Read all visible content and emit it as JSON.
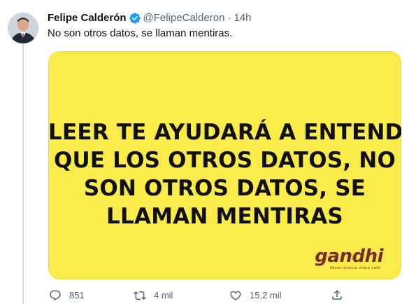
{
  "author": {
    "display_name": "Felipe Calderón",
    "handle": "@FelipeCalderon",
    "separator": "·",
    "time": "14h",
    "verified": true
  },
  "tweet": {
    "text": "No son otros datos, se llaman mentiras."
  },
  "media": {
    "background_color": "#f9ec4a",
    "lines": [
      "LEER TE AYUDARÁ A ENTENDER",
      "QUE LOS OTROS DATOS, NO",
      "SON OTROS DATOS, SE",
      "LLAMAN MENTIRAS"
    ],
    "brand": {
      "name": "gandhi",
      "tagline": "libros música video café"
    }
  },
  "actions": {
    "reply": {
      "icon": "reply-icon",
      "count": "851"
    },
    "retweet": {
      "icon": "retweet-icon",
      "count": "4 mil"
    },
    "like": {
      "icon": "heart-icon",
      "count": "15,2 mil"
    },
    "share": {
      "icon": "share-icon"
    }
  },
  "colors": {
    "text_primary": "#0f1419",
    "text_secondary": "#536471",
    "verified_blue": "#1d9bf0",
    "media_yellow": "#f9ec4a",
    "brand_maroon": "#7a2b2b",
    "thread_line": "#cfd9de"
  }
}
